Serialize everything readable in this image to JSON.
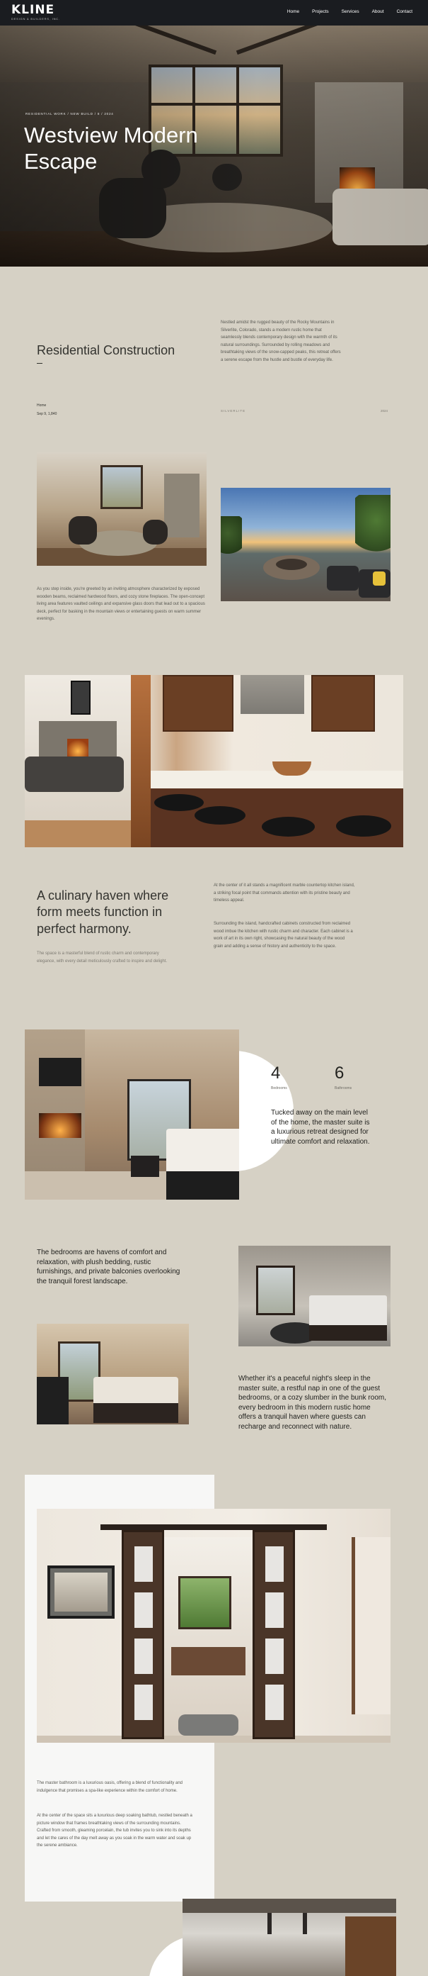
{
  "header": {
    "logo": "KLINE",
    "logo_sub": "DESIGN & BUILDERS, INC.",
    "nav": [
      "Home",
      "Projects",
      "Services",
      "About",
      "Contact"
    ]
  },
  "hero": {
    "breadcrumb": "RESIDENTIAL WORK / NEW BUILD / 8 / 2024",
    "title": "Westview Modern Escape"
  },
  "intro": {
    "heading": "Residential Construction",
    "dash": "–",
    "text": "Nestled amidst the rugged beauty of the Rocky Mountains in Silverlite, Colorado, stands a modern rustic home that seamlessly blends contemporary design with the warmth of its natural surroundings. Surrounded by rolling meadows and breathtaking views of the snow-capped peaks, this retreat offers a serene escape from the hustle and bustle of everyday life.",
    "meta_label": "Home",
    "meta_date": "Sep 9, 1,840",
    "meta_mid": "SILVERLITE",
    "meta_right": "2024"
  },
  "para1": "As you step inside, you're greeted by an inviting atmosphere characterized by exposed wooden beams, reclaimed hardwood floors, and cozy stone fireplaces. The open-concept living area features vaulted ceilings and expansive glass doors that lead out to a spacious deck, perfect for basking in the mountain views or entertaining guests on warm summer evenings.",
  "culinary": {
    "heading": "A culinary haven where form meets function in perfect harmony.",
    "small": "The space is a masterful blend of rustic charm and contemporary elegance, with every detail meticulously crafted to inspire and delight.",
    "text1": "At the center of it all stands a magnificent marble countertop kitchen island, a striking focal point that commands attention with its pristine beauty and timeless appeal.",
    "text2": "Surrounding the island, handcrafted cabinets constructed from reclaimed wood imbue the kitchen with rustic charm and character. Each cabinet is a work of art in its own right, showcasing the natural beauty of the wood grain and adding a sense of history and authenticity to the space."
  },
  "stats": {
    "bedrooms_value": "4",
    "bedrooms_label": "Bedrooms",
    "bathrooms_value": "6",
    "bathrooms_label": "Bathrooms"
  },
  "master_text": "Tucked away on the main level of the home, the master suite is a luxurious retreat designed for ultimate comfort and relaxation.",
  "beds_text": "The bedrooms are havens of comfort and relaxation, with plush bedding, rustic furnishings, and private balconies overlooking the tranquil forest landscape.",
  "guest_text": "Whether it's a peaceful night's sleep in the master suite, a restful nap in one of the guest bedrooms, or a cozy slumber in the bunk room, every bedroom in this modern rustic home offers a tranquil haven where guests can recharge and reconnect with nature.",
  "bath": {
    "text1": "The master bathroom is a luxurious oasis, offering a blend of functionality and indulgence that promises a spa-like experience within the comfort of home.",
    "text2": "At the center of the space sits a luxurious deep soaking bathtub, nestled beneath a picture window that frames breathtaking views of the surrounding mountains. Crafted from smooth, gleaming porcelain, the tub invites you to sink into its depths and let the cares of the day melt away as you soak in the warm water and soak up the serene ambiance."
  }
}
